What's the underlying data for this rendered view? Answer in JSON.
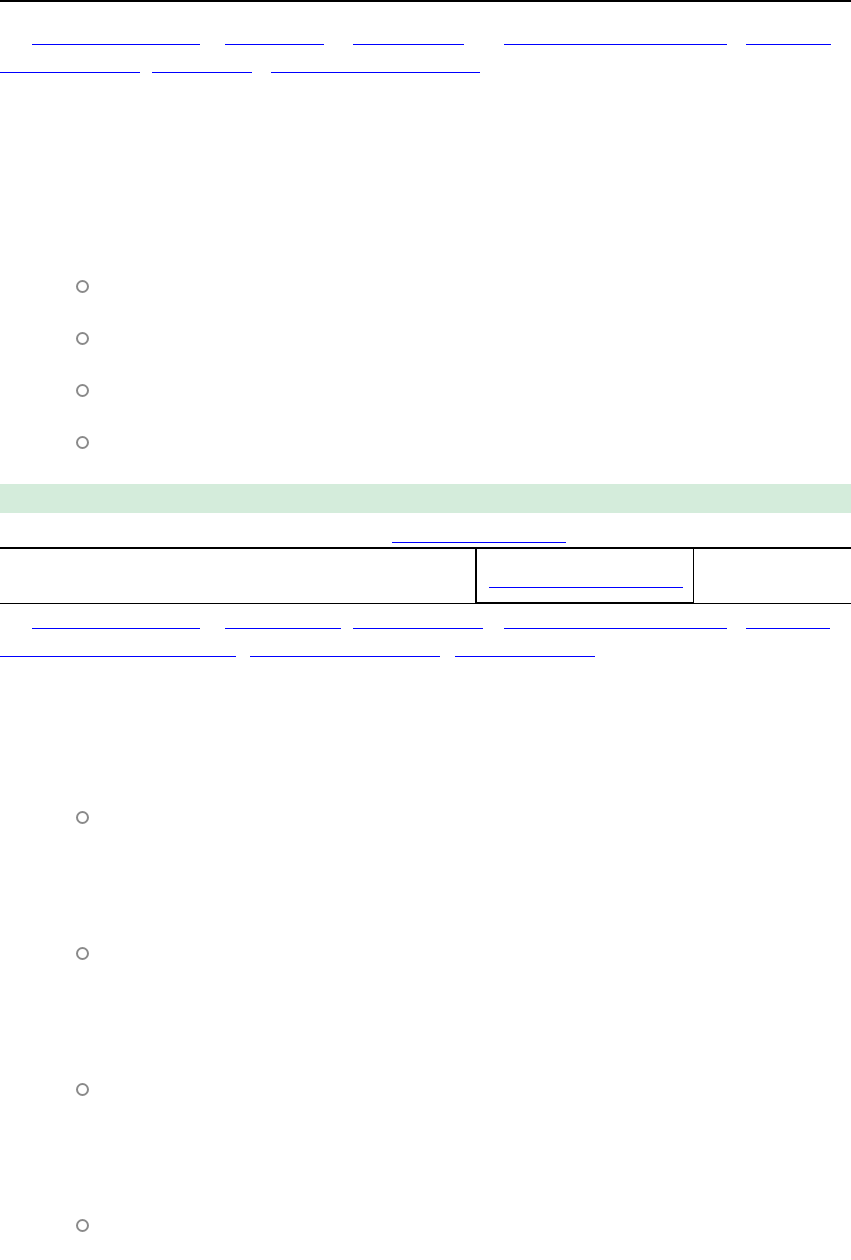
{
  "question_1": {
    "options": [
      {
        "selected": false
      },
      {
        "selected": false
      },
      {
        "selected": false
      },
      {
        "selected": false
      }
    ]
  },
  "question_2": {
    "options": [
      {
        "selected": false
      },
      {
        "selected": false
      },
      {
        "selected": false
      },
      {
        "selected": false
      }
    ]
  }
}
